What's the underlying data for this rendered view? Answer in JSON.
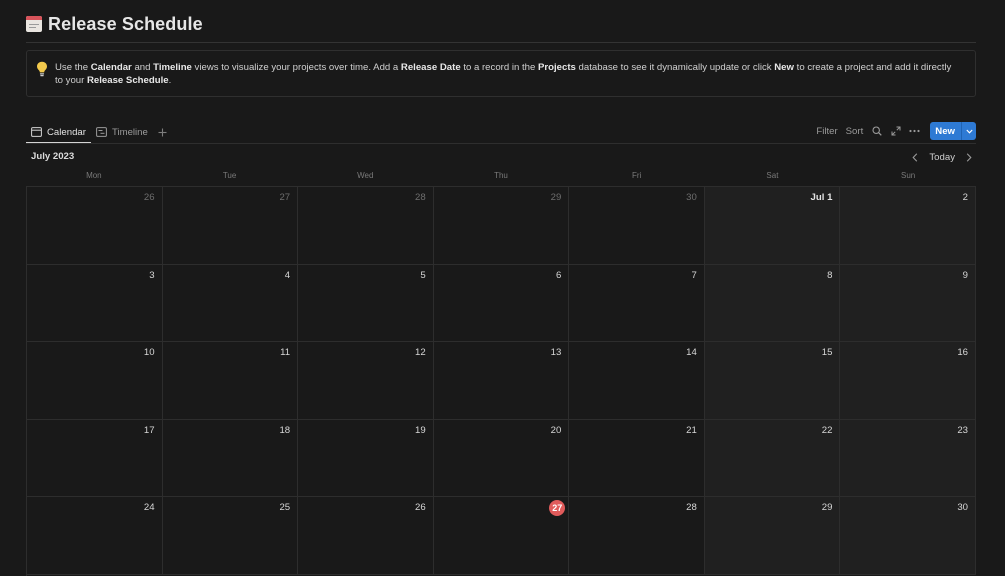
{
  "page": {
    "title": "Release Schedule",
    "icon": "calendar-icon"
  },
  "callout": {
    "icon": "lightbulb-icon",
    "segments": [
      {
        "text": "Use the ",
        "bold": false
      },
      {
        "text": "Calendar",
        "bold": true
      },
      {
        "text": " and ",
        "bold": false
      },
      {
        "text": "Timeline",
        "bold": true
      },
      {
        "text": " views to visualize your projects over time. Add a ",
        "bold": false
      },
      {
        "text": "Release Date",
        "bold": true
      },
      {
        "text": " to a record in the ",
        "bold": false
      },
      {
        "text": "Projects",
        "bold": true
      },
      {
        "text": " database to see it dynamically update or click ",
        "bold": false
      },
      {
        "text": "New",
        "bold": true
      },
      {
        "text": " to create a project and add it directly to your ",
        "bold": false
      },
      {
        "text": "Release Schedule",
        "bold": true
      },
      {
        "text": ".",
        "bold": false
      }
    ]
  },
  "tabs": [
    {
      "label": "Calendar",
      "icon": "calendar-view-icon",
      "active": true
    },
    {
      "label": "Timeline",
      "icon": "timeline-view-icon",
      "active": false
    }
  ],
  "toolbar": {
    "filter_label": "Filter",
    "sort_label": "Sort",
    "new_label": "New",
    "accent": "#2e7ad4"
  },
  "calendar": {
    "month_label": "July 2023",
    "today_label": "Today",
    "weekdays": [
      "Mon",
      "Tue",
      "Wed",
      "Thu",
      "Fri",
      "Sat",
      "Sun"
    ],
    "today_color": "#e05b5b",
    "weeks": [
      [
        {
          "label": "26",
          "out": true
        },
        {
          "label": "27",
          "out": true
        },
        {
          "label": "28",
          "out": true
        },
        {
          "label": "29",
          "out": true
        },
        {
          "label": "30",
          "out": true
        },
        {
          "label": "Jul 1",
          "first": true
        },
        {
          "label": "2"
        }
      ],
      [
        {
          "label": "3"
        },
        {
          "label": "4"
        },
        {
          "label": "5"
        },
        {
          "label": "6"
        },
        {
          "label": "7"
        },
        {
          "label": "8"
        },
        {
          "label": "9"
        }
      ],
      [
        {
          "label": "10"
        },
        {
          "label": "11"
        },
        {
          "label": "12"
        },
        {
          "label": "13"
        },
        {
          "label": "14"
        },
        {
          "label": "15"
        },
        {
          "label": "16"
        }
      ],
      [
        {
          "label": "17"
        },
        {
          "label": "18"
        },
        {
          "label": "19"
        },
        {
          "label": "20"
        },
        {
          "label": "21"
        },
        {
          "label": "22"
        },
        {
          "label": "23"
        }
      ],
      [
        {
          "label": "24"
        },
        {
          "label": "25"
        },
        {
          "label": "26"
        },
        {
          "label": "27",
          "today": true
        },
        {
          "label": "28"
        },
        {
          "label": "29"
        },
        {
          "label": "30"
        }
      ]
    ]
  }
}
